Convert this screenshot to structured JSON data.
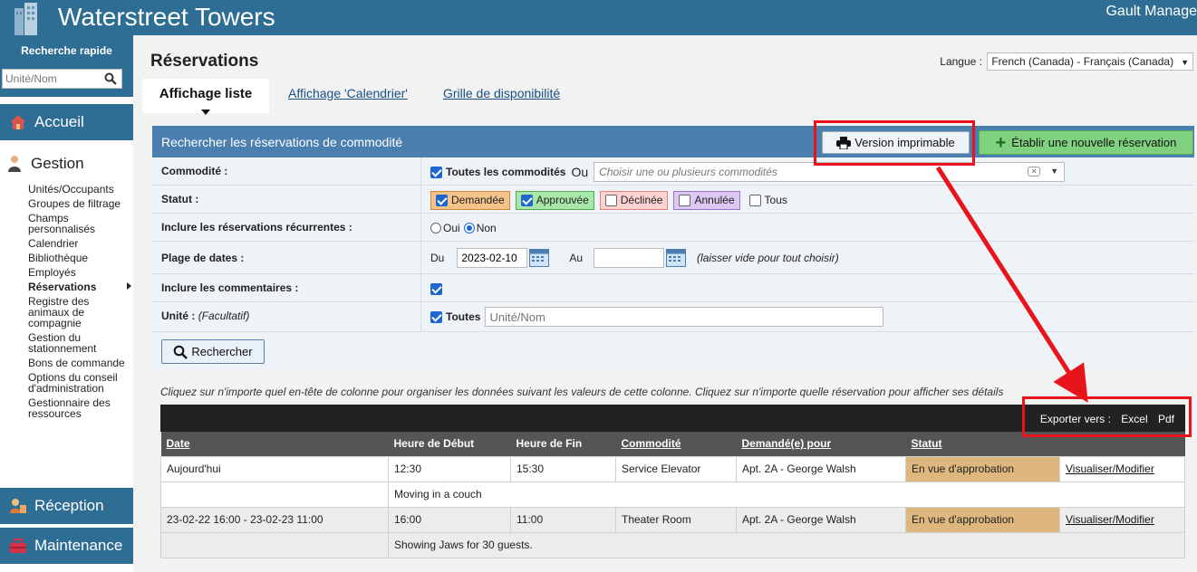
{
  "header": {
    "site_title": "Waterstreet Towers",
    "company": "Gault Manage"
  },
  "sidebar": {
    "quick_search_label": "Recherche rapide",
    "quick_search_placeholder": "Unité/Nom",
    "accueil": "Accueil",
    "gestion": "Gestion",
    "submenu": [
      "Unités/Occupants",
      "Groupes de filtrage",
      "Champs personnalisés",
      "Calendrier",
      "Bibliothèque",
      "Employés",
      "Réservations",
      "Registre des animaux de compagnie",
      "Gestion du stationnement",
      "Bons de commande",
      "Options du conseil d'administration",
      "Gestionnaire des ressources"
    ],
    "active_submenu": "Réservations",
    "reception": "Réception",
    "maintenance": "Maintenance"
  },
  "page": {
    "title": "Réservations",
    "language_label": "Langue :",
    "language_value": "French (Canada) - Français (Canada)",
    "tabs": [
      "Affichage liste",
      "Affichage 'Calendrier'",
      "Grille de disponibilité"
    ]
  },
  "search": {
    "header": "Rechercher les réservations de commodité",
    "print_button": "Version imprimable",
    "new_button": "Établir une nouvelle réservation",
    "amenity_label": "Commodité :",
    "amenity_all": "Toutes les commodités",
    "amenity_or": "Ou",
    "amenity_placeholder": "Choisir une ou plusieurs commodités",
    "status_label": "Statut :",
    "statuses": [
      "Demandée",
      "Approuvée",
      "Déclinée",
      "Annulée",
      "Tous"
    ],
    "recurring_label": "Inclure les réservations récurrentes :",
    "recurring_yes": "Oui",
    "recurring_no": "Non",
    "date_label": "Plage de dates :",
    "date_from_label": "Du",
    "date_from": "2023-02-10",
    "date_to_label": "Au",
    "date_to": "",
    "date_hint": "(laisser vide pour tout choisir)",
    "comments_label": "Inclure les commentaires :",
    "unit_label": "Unité :",
    "unit_optional": "(Facultatif)",
    "unit_all": "Toutes",
    "unit_placeholder": "Unité/Nom",
    "search_button": "Rechercher"
  },
  "results": {
    "hint": "Cliquez sur n'importe quel en-tête de colonne pour organiser les données suivant les valeurs de cette colonne. Cliquez sur n'importe quelle réservation pour afficher ses détails",
    "export_label": "Exporter vers :",
    "export_excel": "Excel",
    "export_pdf": "Pdf",
    "columns": [
      "Date",
      "Heure de Début",
      "Heure de Fin",
      "Commodité",
      "Demandé(e) pour",
      "Statut",
      ""
    ],
    "rows": [
      {
        "date": "Aujourd'hui",
        "start": "12:30",
        "end": "15:30",
        "amenity": "Service Elevator",
        "requested_for": "Apt. 2A - George Walsh",
        "status": "En vue d'approbation",
        "action": "Visualiser/Modifier",
        "comment": "Moving in a couch"
      },
      {
        "date": "23-02-22 16:00 - 23-02-23 11:00",
        "start": "16:00",
        "end": "11:00",
        "amenity": "Theater Room",
        "requested_for": "Apt. 2A - George Walsh",
        "status": "En vue d'approbation",
        "action": "Visualiser/Modifier",
        "comment": "Showing Jaws for 30 guests."
      }
    ]
  },
  "colors": {
    "banner": "#2e6d94",
    "panel_header": "#4a7fb0",
    "highlight": "#e8141b",
    "status_pending": "#ddb77e"
  }
}
